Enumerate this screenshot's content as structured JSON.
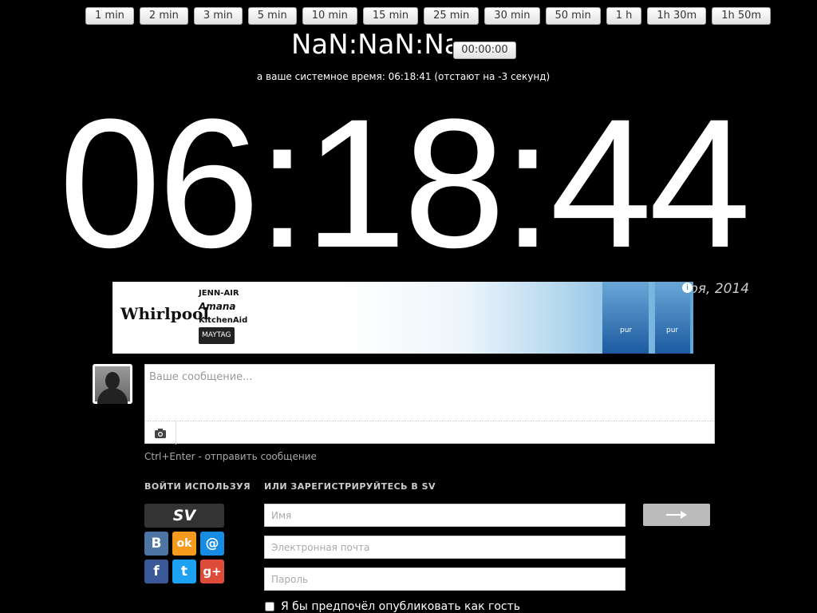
{
  "presets": [
    "1 min",
    "2 min",
    "3 min",
    "5 min",
    "10 min",
    "15 min",
    "25 min",
    "30 min",
    "50 min",
    "1 h",
    "1h 30m",
    "1h 50m"
  ],
  "countdown": {
    "display": "NaN:NaN:Na",
    "reset_label": "00:00:00"
  },
  "system_time_text": "а ваше системное время: 06:18:41 (отстают на -3 секунд)",
  "clock": "06:18:44",
  "date_text": "ря, 2014",
  "ad": {
    "whirlpool": "Whirlpool",
    "brands": [
      "JENN-AIR",
      "Amana",
      "KitchenAid"
    ],
    "maytag": "MAYTAG",
    "bottle_labels": [
      "pur",
      "pur"
    ],
    "info": "i"
  },
  "comment": {
    "placeholder": "Ваше сообщение...",
    "hint": "Ctrl+Enter - отправить сообщение"
  },
  "login": {
    "title": "ВОЙТИ ИСПОЛЬЗУЯ",
    "sv_label": "SV",
    "social": [
      {
        "name": "vk",
        "glyph": "B",
        "color": "#4c75a3"
      },
      {
        "name": "odnoklassniki",
        "glyph": "ok",
        "color": "#f59a1c"
      },
      {
        "name": "mailru",
        "glyph": "@",
        "color": "#168de2"
      },
      {
        "name": "facebook",
        "glyph": "f",
        "color": "#3b5998"
      },
      {
        "name": "twitter",
        "glyph": "t",
        "color": "#1da1f2"
      },
      {
        "name": "googleplus",
        "glyph": "g+",
        "color": "#dd4b39"
      }
    ]
  },
  "register": {
    "title": "ИЛИ ЗАРЕГИСТРИРУЙТЕСЬ В SV",
    "name_placeholder": "Имя",
    "email_placeholder": "Электронная почта",
    "password_placeholder": "Пароль",
    "guest_label": "Я бы предпочёл опубликовать как гость"
  }
}
